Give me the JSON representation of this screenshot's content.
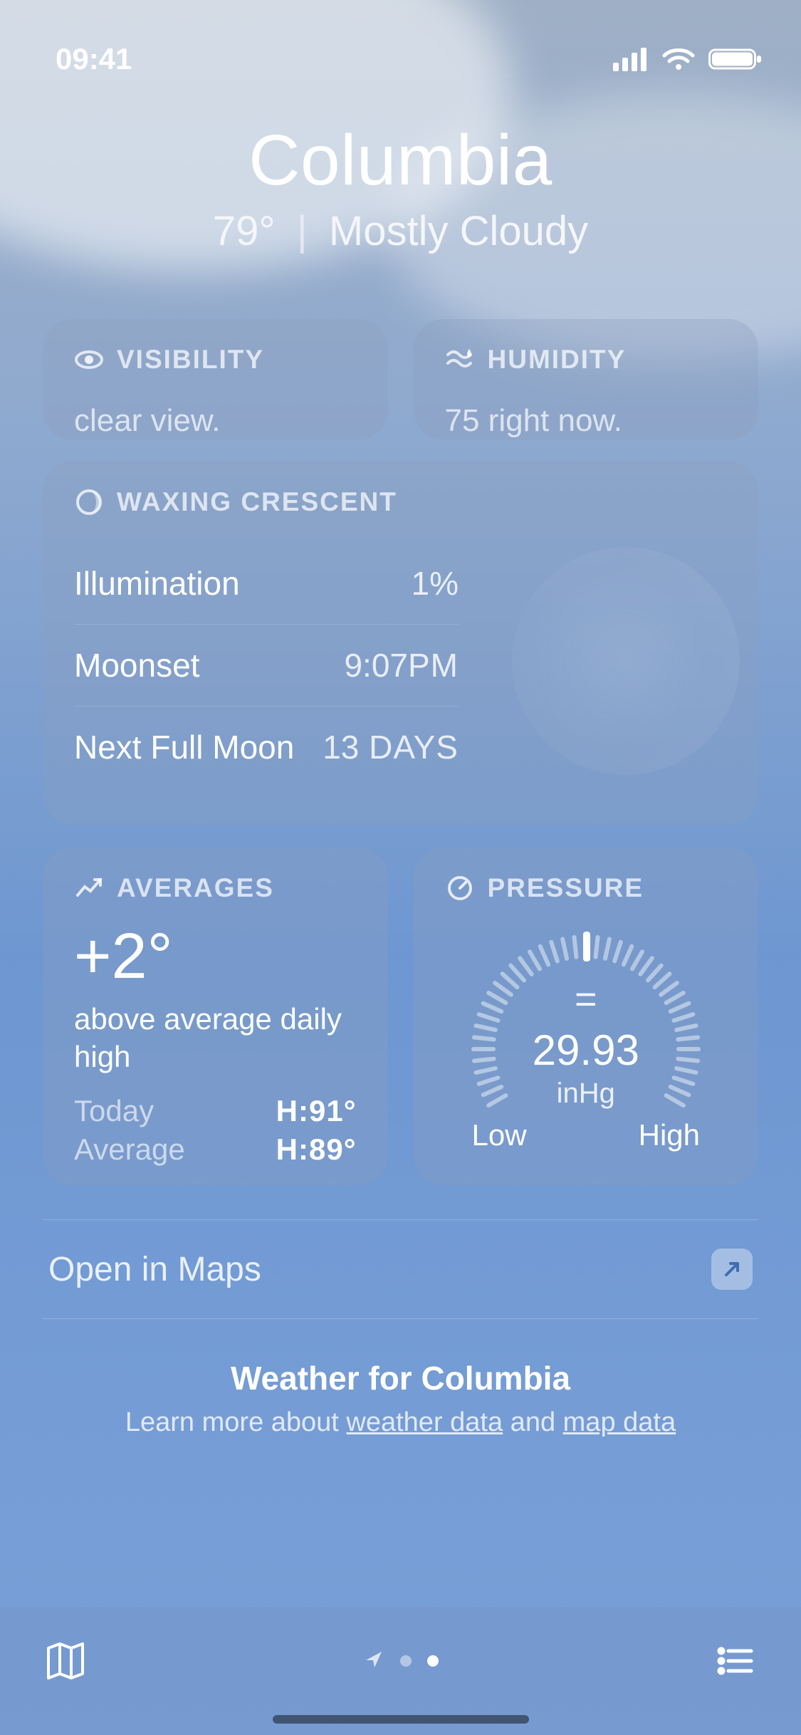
{
  "status": {
    "time": "09:41"
  },
  "header": {
    "city": "Columbia",
    "temp": "79°",
    "condition": "Mostly Cloudy"
  },
  "cards": {
    "visibility": {
      "title": "VISIBILITY",
      "body": "clear view."
    },
    "humidity": {
      "title": "HUMIDITY",
      "body": "75  right now."
    }
  },
  "moon": {
    "title": "WAXING CRESCENT",
    "rows": {
      "illumination": {
        "label": "Illumination",
        "value": "1%"
      },
      "moonset": {
        "label": "Moonset",
        "value": "9:07",
        "suffix": "PM"
      },
      "nextFullMoon": {
        "label": "Next Full Moon",
        "value": "13",
        "suffix": " DAYS"
      }
    }
  },
  "averages": {
    "title": "AVERAGES",
    "delta": "+2°",
    "text": "above average daily high",
    "today_label": "Today",
    "today_value": "H:91°",
    "avg_label": "Average",
    "avg_value": "H:89°"
  },
  "pressure": {
    "title": "PRESSURE",
    "trend": "=",
    "value": "29.93",
    "unit": "inHg",
    "low": "Low",
    "high": "High"
  },
  "maps": {
    "label": "Open in Maps"
  },
  "footer": {
    "title": "Weather for Columbia",
    "prefix": "Learn more about ",
    "link1": "weather data",
    "mid": " and ",
    "link2": "map data"
  }
}
